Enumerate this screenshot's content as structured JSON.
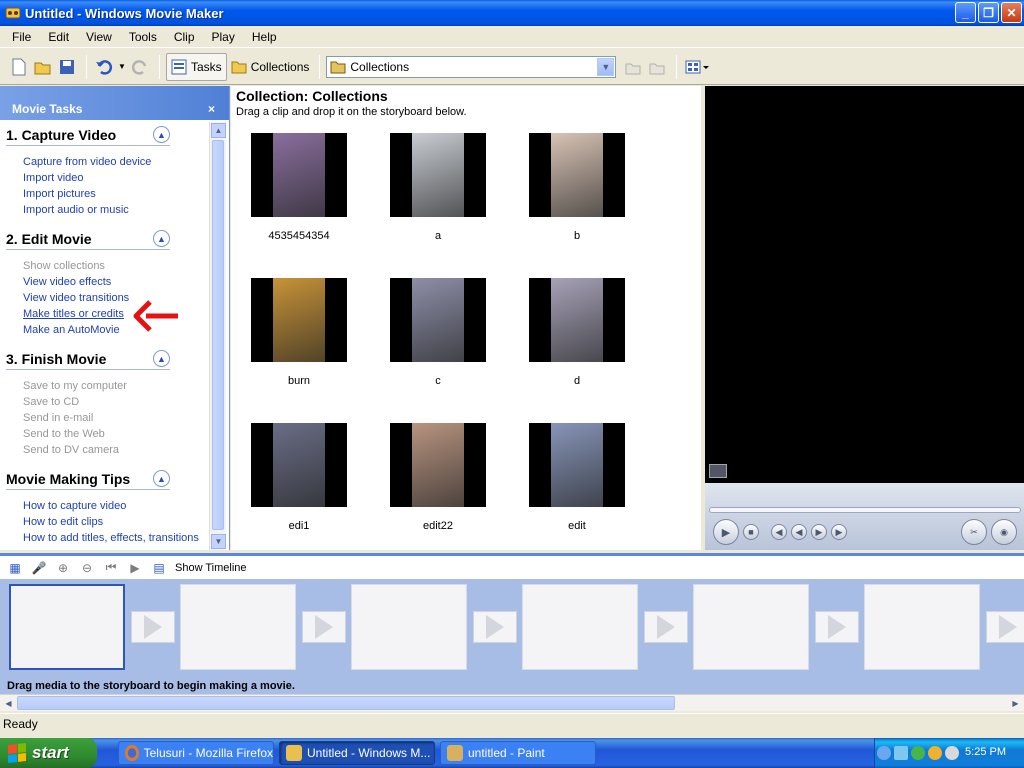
{
  "window": {
    "title": "Untitled - Windows Movie Maker",
    "controls": [
      "_",
      "❐",
      "✕"
    ]
  },
  "menu": [
    "File",
    "Edit",
    "View",
    "Tools",
    "Clip",
    "Play",
    "Help"
  ],
  "toolbar": {
    "tasks_label": "Tasks",
    "collections_label": "Collections",
    "collection_combo_value": "Collections"
  },
  "taskpane": {
    "header": "Movie Tasks",
    "close_glyph": "×",
    "sections": [
      {
        "title": "1. Capture Video",
        "links": [
          {
            "label": "Capture from video device",
            "enabled": true
          },
          {
            "label": "Import video",
            "enabled": true
          },
          {
            "label": "Import pictures",
            "enabled": true
          },
          {
            "label": "Import audio or music",
            "enabled": true
          }
        ]
      },
      {
        "title": "2. Edit Movie",
        "links": [
          {
            "label": "Show collections",
            "enabled": false
          },
          {
            "label": "View video effects",
            "enabled": true
          },
          {
            "label": "View video transitions",
            "enabled": true
          },
          {
            "label": "Make titles or credits",
            "enabled": true
          },
          {
            "label": "Make an AutoMovie",
            "enabled": true
          }
        ]
      },
      {
        "title": "3. Finish Movie",
        "links": [
          {
            "label": "Save to my computer",
            "enabled": false
          },
          {
            "label": "Save to CD",
            "enabled": false
          },
          {
            "label": "Send in e-mail",
            "enabled": false
          },
          {
            "label": "Send to the Web",
            "enabled": false
          },
          {
            "label": "Send to DV camera",
            "enabled": false
          }
        ]
      },
      {
        "title": "Movie Making Tips",
        "links": [
          {
            "label": "How to capture video",
            "enabled": true
          },
          {
            "label": "How to edit clips",
            "enabled": true
          },
          {
            "label": "How to add titles, effects, transitions",
            "enabled": true
          }
        ]
      }
    ]
  },
  "collection": {
    "title": "Collection: Collections",
    "subtitle": "Drag a clip and drop it on the storyboard below.",
    "clips": [
      {
        "label": "4535454354",
        "color": "#8a6f9e"
      },
      {
        "label": "a",
        "color": "#c9cdd3"
      },
      {
        "label": "b",
        "color": "#d8c3b5"
      },
      {
        "label": "burn",
        "color": "#c79338"
      },
      {
        "label": "c",
        "color": "#8e8fa8"
      },
      {
        "label": "d",
        "color": "#a7a2b8"
      },
      {
        "label": "edi1",
        "color": "#6a6e86"
      },
      {
        "label": "edit22",
        "color": "#b89480"
      },
      {
        "label": "edit",
        "color": "#8795b8"
      }
    ]
  },
  "storyboard": {
    "toolbar_label": "Show Timeline",
    "message": "Drag media to the storyboard to begin making a movie."
  },
  "status": {
    "text": "Ready"
  },
  "taskbar": {
    "start_label": "start",
    "tasks": [
      {
        "label": "Telusuri - Mozilla Firefox",
        "active": false
      },
      {
        "label": "Untitled - Windows M...",
        "active": true
      },
      {
        "label": "untitled - Paint",
        "active": false
      }
    ],
    "clock": "5:25 PM"
  }
}
